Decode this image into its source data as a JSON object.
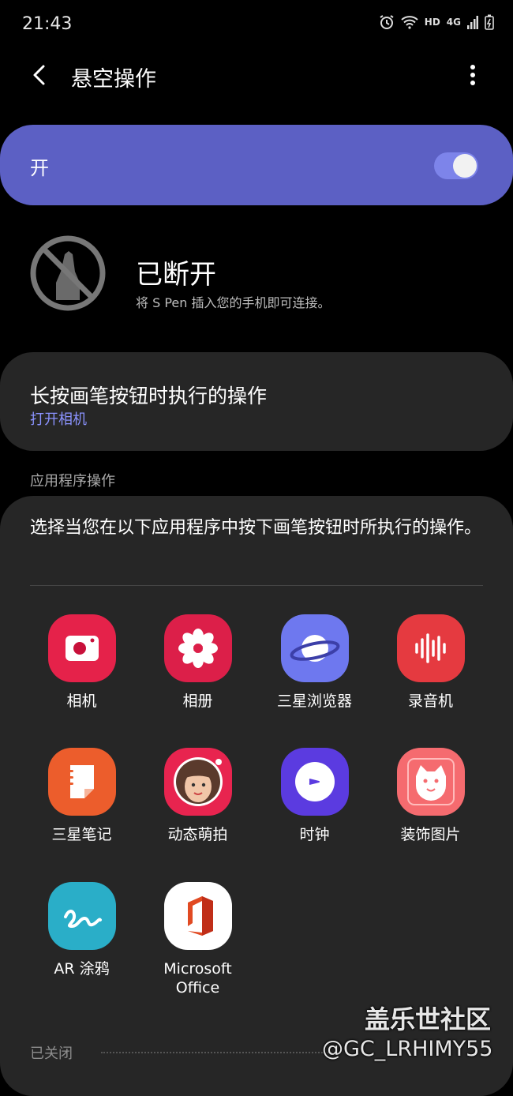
{
  "status_bar": {
    "time": "21:43",
    "network": "HD",
    "signal_type": "4G",
    "icons": [
      "alarm-icon",
      "wifi-icon",
      "signal-icon",
      "battery-icon"
    ]
  },
  "app_bar": {
    "title": "悬空操作",
    "icons": [
      "back-arrow-icon",
      "more-options-icon"
    ]
  },
  "master_toggle": {
    "label": "开",
    "on": true,
    "accent": "#5c60c4"
  },
  "connection": {
    "status": "已断开",
    "hint": "将 S Pen 插入您的手机即可连接。",
    "icon": "pen-disconnected-icon"
  },
  "long_press": {
    "title": "长按画笔按钮时执行的操作",
    "value": "打开相机",
    "value_color": "#8b93ff"
  },
  "app_actions": {
    "section_label": "应用程序操作",
    "description": "选择当您在以下应用程序中按下画笔按钮时所执行的操作。",
    "apps": [
      {
        "label": "相机",
        "icon": "camera-icon",
        "color": "#e5224a"
      },
      {
        "label": "相册",
        "icon": "gallery-flower-icon",
        "color": "#dc1f49"
      },
      {
        "label": "三星浏览器",
        "icon": "internet-planet-icon",
        "color": "#6e78ef"
      },
      {
        "label": "录音机",
        "icon": "voice-recorder-icon",
        "color": "#e53a40"
      },
      {
        "label": "三星笔记",
        "icon": "notes-icon",
        "color": "#ec5d2c"
      },
      {
        "label": "动态萌拍",
        "icon": "ar-emoji-icon",
        "color": "#e8244f"
      },
      {
        "label": "时钟",
        "icon": "clock-icon",
        "color": "#5b3be0"
      },
      {
        "label": "装饰图片",
        "icon": "photo-editor-cat-icon",
        "color": "#f56b6f"
      },
      {
        "label": "AR 涂鸦",
        "icon": "ar-doodle-icon",
        "color": "#2aaec8"
      },
      {
        "label": "Microsoft Office",
        "label_line1": "Microsoft",
        "label_line2": "Office",
        "icon": "office-icon",
        "color": "#ffffff"
      }
    ]
  },
  "footer": {
    "label": "已关闭"
  },
  "watermark": {
    "line1": "盖乐世社区",
    "line2": "@GC_LRHIMY55"
  }
}
